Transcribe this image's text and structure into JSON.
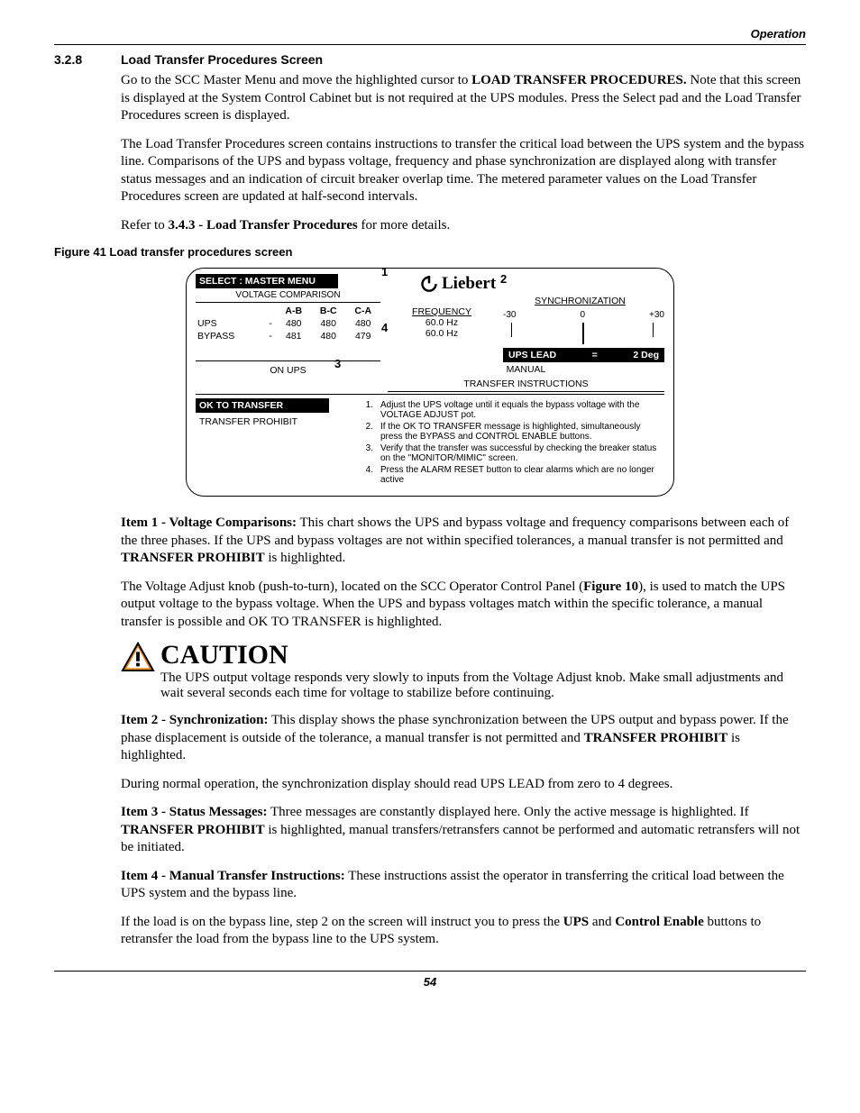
{
  "running_head": "Operation",
  "section": {
    "num": "3.2.8",
    "title": "Load Transfer Procedures Screen"
  },
  "para1_a": "Go to the SCC Master Menu and move the highlighted cursor to ",
  "para1_b_bold": "LOAD TRANSFER PROCEDURES.",
  "para1_c": " Note that this screen is displayed at the System Control Cabinet but is not required at the UPS modules. Press the Select pad and the Load Transfer Procedures screen is displayed.",
  "para2": "The Load Transfer Procedures screen contains instructions to transfer the critical load between the UPS system and the bypass line. Comparisons of the UPS and bypass voltage, frequency and phase synchronization are displayed along with transfer status messages and an indication of circuit breaker overlap time. The metered parameter values on the Load Transfer Procedures screen are updated at half-second intervals.",
  "para3_a": "Refer to ",
  "para3_b_bold": "3.4.3 - Load Transfer Procedures",
  "para3_c": " for more details.",
  "figcap": "Figure 41  Load transfer procedures screen",
  "screen": {
    "select_line": "SELECT  :  MASTER MENU",
    "vc_label": "VOLTAGE COMPARISON",
    "brand": "Liebert",
    "vc_headers": [
      "",
      "A-B",
      "B-C",
      "C-A"
    ],
    "vc_rows": [
      {
        "label": "UPS",
        "dash": "-",
        "ab": "480",
        "bc": "480",
        "ca": "480"
      },
      {
        "label": "BYPASS",
        "dash": "-",
        "ab": "481",
        "bc": "480",
        "ca": "479"
      }
    ],
    "on_ups": "ON UPS",
    "ok_to_transfer": "OK  TO  TRANSFER",
    "transfer_prohibit": "TRANSFER PROHIBIT",
    "freq_label": "FREQUENCY",
    "freq_ups": "60.0 Hz",
    "freq_bypass": "60.0 Hz",
    "sync_label": "SYNCHRONIZATION",
    "sync_scale": {
      "neg": "-30",
      "zero": "0",
      "pos": "+30"
    },
    "sync_status": {
      "lead": "UPS  LEAD",
      "eq": "=",
      "val": "2 Deg"
    },
    "manual_label": "MANUAL",
    "instr_title": "TRANSFER INSTRUCTIONS",
    "steps": [
      "Adjust the UPS voltage until it equals the bypass voltage with the VOLTAGE ADJUST pot.",
      "If the OK TO TRANSFER message is highlighted, simultaneously press the BYPASS  and CONTROL ENABLE buttons.",
      "Verify that the transfer was successful by checking the  breaker status on the \"MONITOR/MIMIC\" screen.",
      "Press the ALARM RESET button to clear alarms which are no longer active"
    ],
    "callouts": {
      "c1": "1",
      "c2": "2",
      "c3": "3",
      "c4": "4"
    }
  },
  "item1_lead": "Item 1 - Voltage Comparisons:",
  "item1_body_a": " This chart shows the UPS and bypass voltage and frequency comparisons between each of the three phases. If the UPS and bypass voltages are not within specified tolerances, a manual transfer is not permitted and ",
  "item1_body_b_bold": "TRANSFER PROHIBIT",
  "item1_body_c": " is highlighted.",
  "item1_para2_a": "The Voltage Adjust knob (push-to-turn), located on the SCC Operator Control Panel (",
  "item1_para2_b_bold": "Figure 10",
  "item1_para2_c": "), is used to match the UPS output voltage to the bypass voltage. When the UPS and bypass voltages match within the specific tolerance, a manual transfer is possible and OK TO TRANSFER is highlighted.",
  "caution_title": "CAUTION",
  "caution_body": "The UPS output voltage responds very slowly to inputs from the Voltage Adjust knob. Make small adjustments and wait several seconds each time for voltage to stabilize before continuing.",
  "item2_lead": "Item 2 - Synchronization:",
  "item2_body_a": " This display shows the phase synchronization between the UPS output and bypass power. If the phase displacement is outside of the tolerance, a manual transfer is not permitted and ",
  "item2_body_b_bold": "TRANSFER PROHIBIT",
  "item2_body_c": " is highlighted.",
  "item2_para2": "During normal operation, the synchronization display should read UPS LEAD from zero to 4 degrees.",
  "item3_lead": "Item 3 - Status Messages:",
  "item3_body_a": " Three messages are constantly displayed here. Only the active message is highlighted. If ",
  "item3_body_b_bold": "TRANSFER PROHIBIT",
  "item3_body_c": " is highlighted, manual transfers/retransfers cannot be performed and automatic retransfers will not be initiated.",
  "item4_lead": "Item 4 - Manual Transfer Instructions:",
  "item4_body": " These instructions assist the operator in transferring the critical load between the UPS system and the bypass line.",
  "item4_para2_a": "If the load is on the bypass line, step 2 on the screen will instruct you to press the ",
  "item4_para2_b_bold": "UPS",
  "item4_para2_c": " and ",
  "item4_para2_d_bold": "Control Enable",
  "item4_para2_e": " buttons to retransfer the load from the bypass line to the UPS system.",
  "pagenum": "54"
}
